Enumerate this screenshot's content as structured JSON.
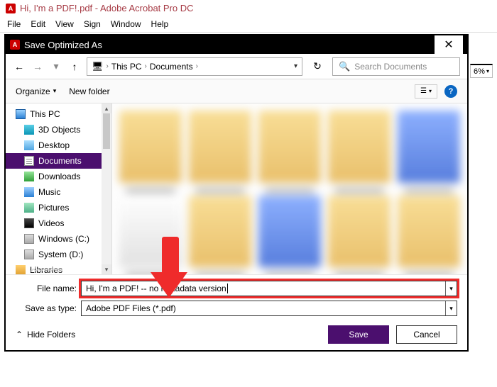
{
  "app": {
    "icon_glyph": "A",
    "title": "Hi, I'm a PDF!.pdf - Adobe Acrobat Pro DC"
  },
  "menu": {
    "items": [
      "File",
      "Edit",
      "View",
      "Sign",
      "Window",
      "Help"
    ]
  },
  "zoom": {
    "value": "6%"
  },
  "dialog": {
    "icon_glyph": "A",
    "title": "Save Optimized As",
    "close": "✕"
  },
  "nav": {
    "back": "←",
    "fwd": "→",
    "recent": "▾",
    "up": "↑",
    "monitor": "🖥",
    "crumbs": [
      "This PC",
      "Documents"
    ],
    "sep": "›",
    "dropdown": "▾",
    "refresh": "↻",
    "search_icon": "🔍",
    "search_placeholder": "Search Documents"
  },
  "toolbar": {
    "organize": "Organize",
    "organize_caret": "▾",
    "new_folder": "New folder",
    "view_glyph": "☰",
    "view_caret": "▾",
    "help_glyph": "?"
  },
  "tree": {
    "items": [
      {
        "label": "This PC",
        "icon": "ic-pc",
        "top": true
      },
      {
        "label": "3D Objects",
        "icon": "ic-3d"
      },
      {
        "label": "Desktop",
        "icon": "ic-desk"
      },
      {
        "label": "Documents",
        "icon": "ic-doc",
        "selected": true
      },
      {
        "label": "Downloads",
        "icon": "ic-down"
      },
      {
        "label": "Music",
        "icon": "ic-music"
      },
      {
        "label": "Pictures",
        "icon": "ic-pic"
      },
      {
        "label": "Videos",
        "icon": "ic-vid"
      },
      {
        "label": "Windows (C:)",
        "icon": "ic-drive"
      },
      {
        "label": "System (D:)",
        "icon": "ic-drive"
      },
      {
        "label": "Libraries",
        "icon": "ic-lib"
      }
    ],
    "scroll_up": "▴",
    "scroll_down": "▾"
  },
  "form": {
    "filename_label": "File name:",
    "filename_value": "Hi, I'm a PDF! -- no metadata version",
    "type_label": "Save as type:",
    "type_value": "Adobe PDF Files (*.pdf)",
    "dd": "▾"
  },
  "footer": {
    "hide_caret": "⌃",
    "hide_label": "Hide Folders",
    "save": "Save",
    "cancel": "Cancel"
  }
}
